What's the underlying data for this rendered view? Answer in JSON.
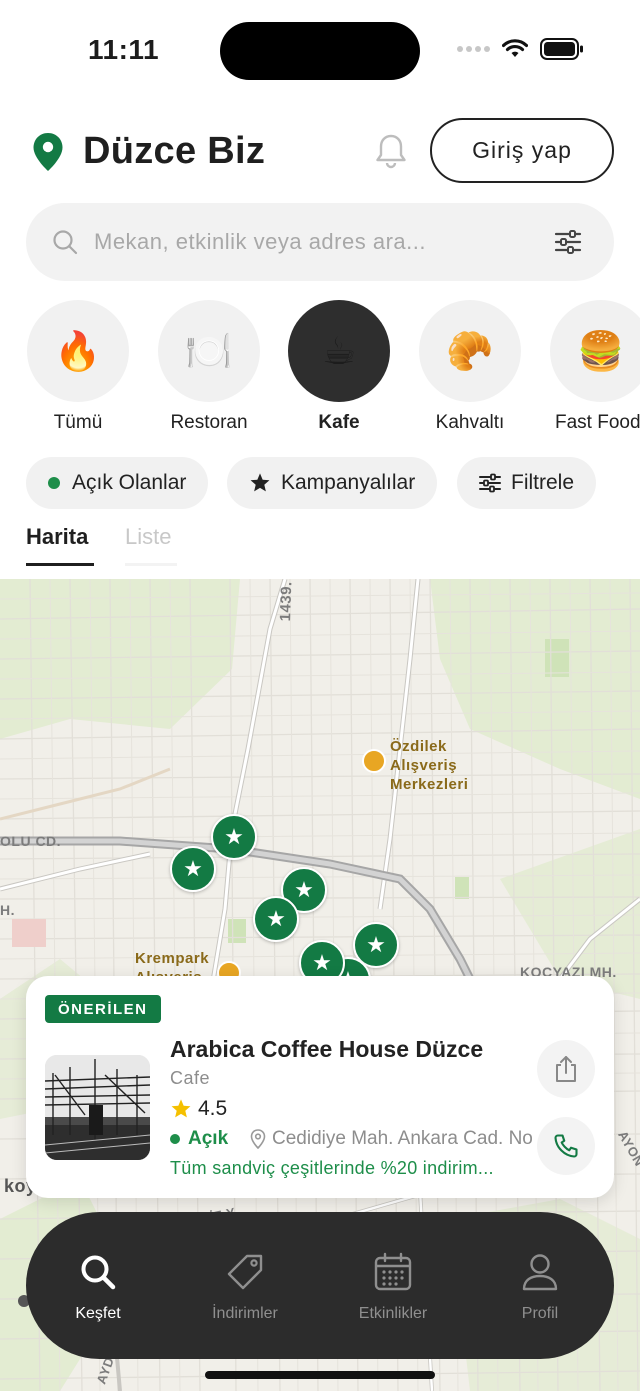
{
  "status_bar": {
    "time": "11:11"
  },
  "header": {
    "title": "Düzce Biz",
    "login_label": "Giriş yap"
  },
  "search": {
    "placeholder": "Mekan, etkinlik veya adres ara..."
  },
  "categories": [
    {
      "emoji": "🔥",
      "label": "Tümü"
    },
    {
      "emoji": "🍽️",
      "label": "Restoran"
    },
    {
      "emoji": "☕",
      "label": "Kafe",
      "active": true
    },
    {
      "emoji": "🥐",
      "label": "Kahvaltı"
    },
    {
      "emoji": "🍔",
      "label": "Fast Food"
    }
  ],
  "filters": {
    "open_now": "Açık Olanlar",
    "campaigns": "Kampanyalılar",
    "filter": "Filtrele"
  },
  "view_tabs": {
    "map": "Harita",
    "list": "Liste",
    "selected": "map"
  },
  "map": {
    "labels": {
      "mall_line1": "Özdilek",
      "mall_line2": "Alışveriş",
      "mall_line3": "Merkezleri",
      "krempark_line1": "Krempark",
      "krempark_line2": "Alışveriş",
      "road_1439": "1439.",
      "olu_cd": "OLU CD.",
      "h_label": "H.",
      "kocyazi": "KOÇYAZI MH.",
      "koy": "koy",
      "aziz": "AZİZ Y",
      "ayon": "AYON",
      "aydi": "AYDI"
    }
  },
  "place_card": {
    "badge": "ÖNERİLEN",
    "name": "Arabica Coffee House Düzce",
    "category": "Cafe",
    "rating": "4.5",
    "status": "Açık",
    "address": "Cedidiye Mah. Ankara Cad. No",
    "promo": "Tüm sandviç çeşitlerinde %20 indirim..."
  },
  "bottom_nav": [
    {
      "label": "Keşfet",
      "icon": "search-icon",
      "active": true
    },
    {
      "label": "İndirimler",
      "icon": "tag-icon"
    },
    {
      "label": "Etkinlikler",
      "icon": "calendar-icon"
    },
    {
      "label": "Profil",
      "icon": "user-icon"
    }
  ],
  "colors": {
    "brand_green": "#137a44",
    "open_green": "#1e8e4a",
    "nav_background": "#2c2c2c",
    "map_background": "#f1efe9"
  }
}
